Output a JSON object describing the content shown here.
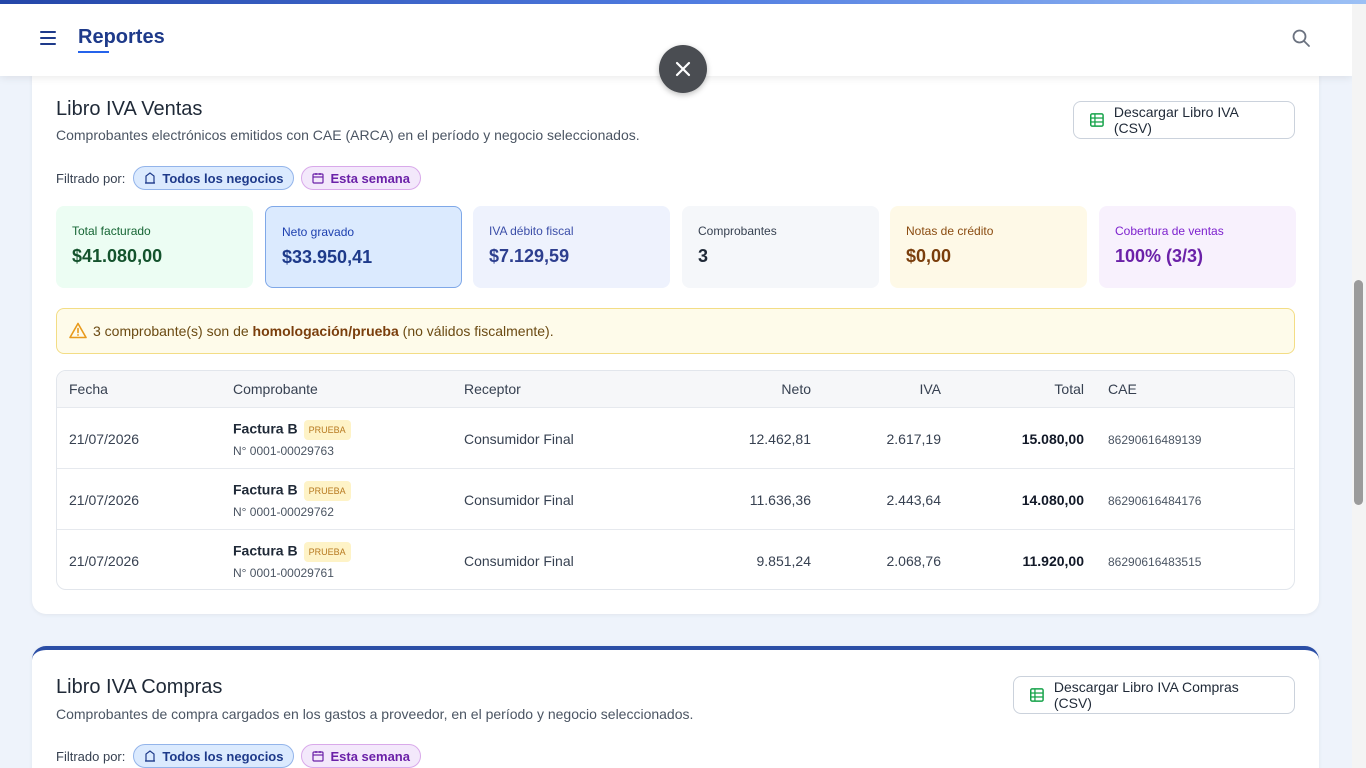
{
  "header": {
    "title": "Reportes"
  },
  "ventas": {
    "title": "Libro IVA Ventas",
    "subtitle": "Comprobantes electrónicos emitidos con CAE (ARCA) en el período y negocio seleccionados.",
    "download_label": "Descargar Libro IVA (CSV)",
    "filter_label": "Filtrado por:",
    "chips": [
      "Todos los negocios",
      "Esta semana"
    ],
    "stats": [
      {
        "label": "Total facturado",
        "value": "$41.080,00",
        "bg": "#ecfdf3",
        "label_color": "#166534",
        "value_color": "#14532d"
      },
      {
        "label": "Neto gravado",
        "value": "$33.950,41",
        "bg": "#dbeafe",
        "label_color": "#1e40af",
        "value_color": "#1e3a8a"
      },
      {
        "label": "IVA débito fiscal",
        "value": "$7.129,59",
        "bg": "#eef2fd",
        "label_color": "#3b4ea8",
        "value_color": "#2e3f8f"
      },
      {
        "label": "Comprobantes",
        "value": "3",
        "bg": "#f5f7fa",
        "label_color": "#374151",
        "value_color": "#1f2937"
      },
      {
        "label": "Notas de crédito",
        "value": "$0,00",
        "bg": "#fef9e7",
        "label_color": "#8a4b10",
        "value_color": "#7a3e0c"
      },
      {
        "label": "Cobertura de ventas",
        "value": "100% (3/3)",
        "bg": "#f8f1fd",
        "label_color": "#7e22ce",
        "value_color": "#6b21a8"
      }
    ],
    "warning": {
      "count_text": "3 comprobante(s) son de ",
      "bold": "homologación/prueba",
      "tail": " (no válidos fiscalmente)."
    },
    "table": {
      "headers": [
        "Fecha",
        "Comprobante",
        "Receptor",
        "Neto",
        "IVA",
        "Total",
        "CAE"
      ],
      "rows": [
        {
          "fecha": "21/07/2026",
          "tipo": "Factura B",
          "badge": "PRUEBA",
          "numero": "N° 0001-00029763",
          "receptor": "Consumidor Final",
          "neto": "12.462,81",
          "iva": "2.617,19",
          "total": "15.080,00",
          "cae": "86290616489139"
        },
        {
          "fecha": "21/07/2026",
          "tipo": "Factura B",
          "badge": "PRUEBA",
          "numero": "N° 0001-00029762",
          "receptor": "Consumidor Final",
          "neto": "11.636,36",
          "iva": "2.443,64",
          "total": "14.080,00",
          "cae": "86290616484176"
        },
        {
          "fecha": "21/07/2026",
          "tipo": "Factura B",
          "badge": "PRUEBA",
          "numero": "N° 0001-00029761",
          "receptor": "Consumidor Final",
          "neto": "9.851,24",
          "iva": "2.068,76",
          "total": "11.920,00",
          "cae": "86290616483515"
        }
      ]
    }
  },
  "compras": {
    "title": "Libro IVA Compras",
    "subtitle": "Comprobantes de compra cargados en los gastos a proveedor, en el período y negocio seleccionados.",
    "download_label": "Descargar Libro IVA Compras (CSV)",
    "filter_label": "Filtrado por:",
    "chips": [
      "Todos los negocios",
      "Esta semana"
    ]
  },
  "icons": {
    "menu": "menu-icon",
    "search": "search-icon",
    "close": "close-icon",
    "spreadsheet": "spreadsheet-icon",
    "building": "building-icon",
    "calendar": "calendar-icon",
    "warning": "warning-icon"
  }
}
